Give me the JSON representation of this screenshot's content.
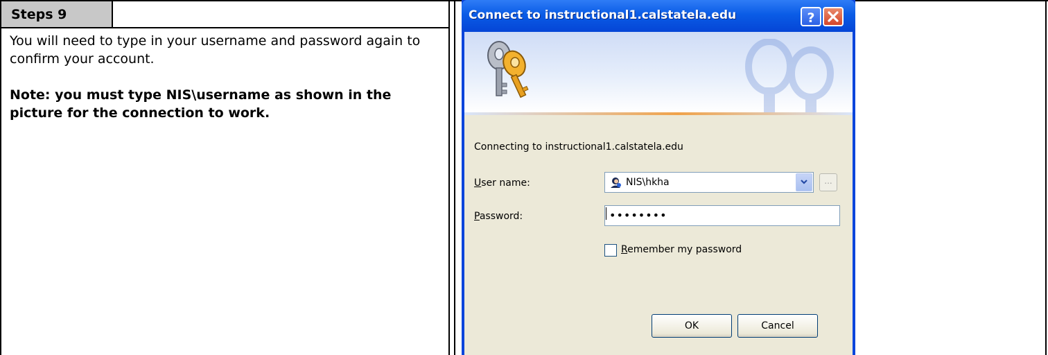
{
  "document": {
    "step_label": "Steps 9",
    "paragraph": "You will need to type in your username and password again to confirm your account.",
    "note": "Note: you must type NIS\\username as shown in the picture for the connection to work."
  },
  "dialog": {
    "title": "Connect to instructional1.calstatela.edu",
    "help_label": "?",
    "connecting_text": "Connecting to instructional1.calstatela.edu",
    "user_label_accel": "U",
    "user_label_rest": "ser name:",
    "user_value": "NIS\\hkha",
    "browse_label": "...",
    "password_label_accel": "P",
    "password_label_rest": "assword:",
    "password_value": "••••••••",
    "remember_accel": "R",
    "remember_rest": "emember my password",
    "remember_checked": false,
    "ok_label": "OK",
    "cancel_label": "Cancel",
    "icons": [
      "keys-icon",
      "user-icon",
      "chevron-down-icon",
      "close-icon",
      "help-icon"
    ]
  }
}
